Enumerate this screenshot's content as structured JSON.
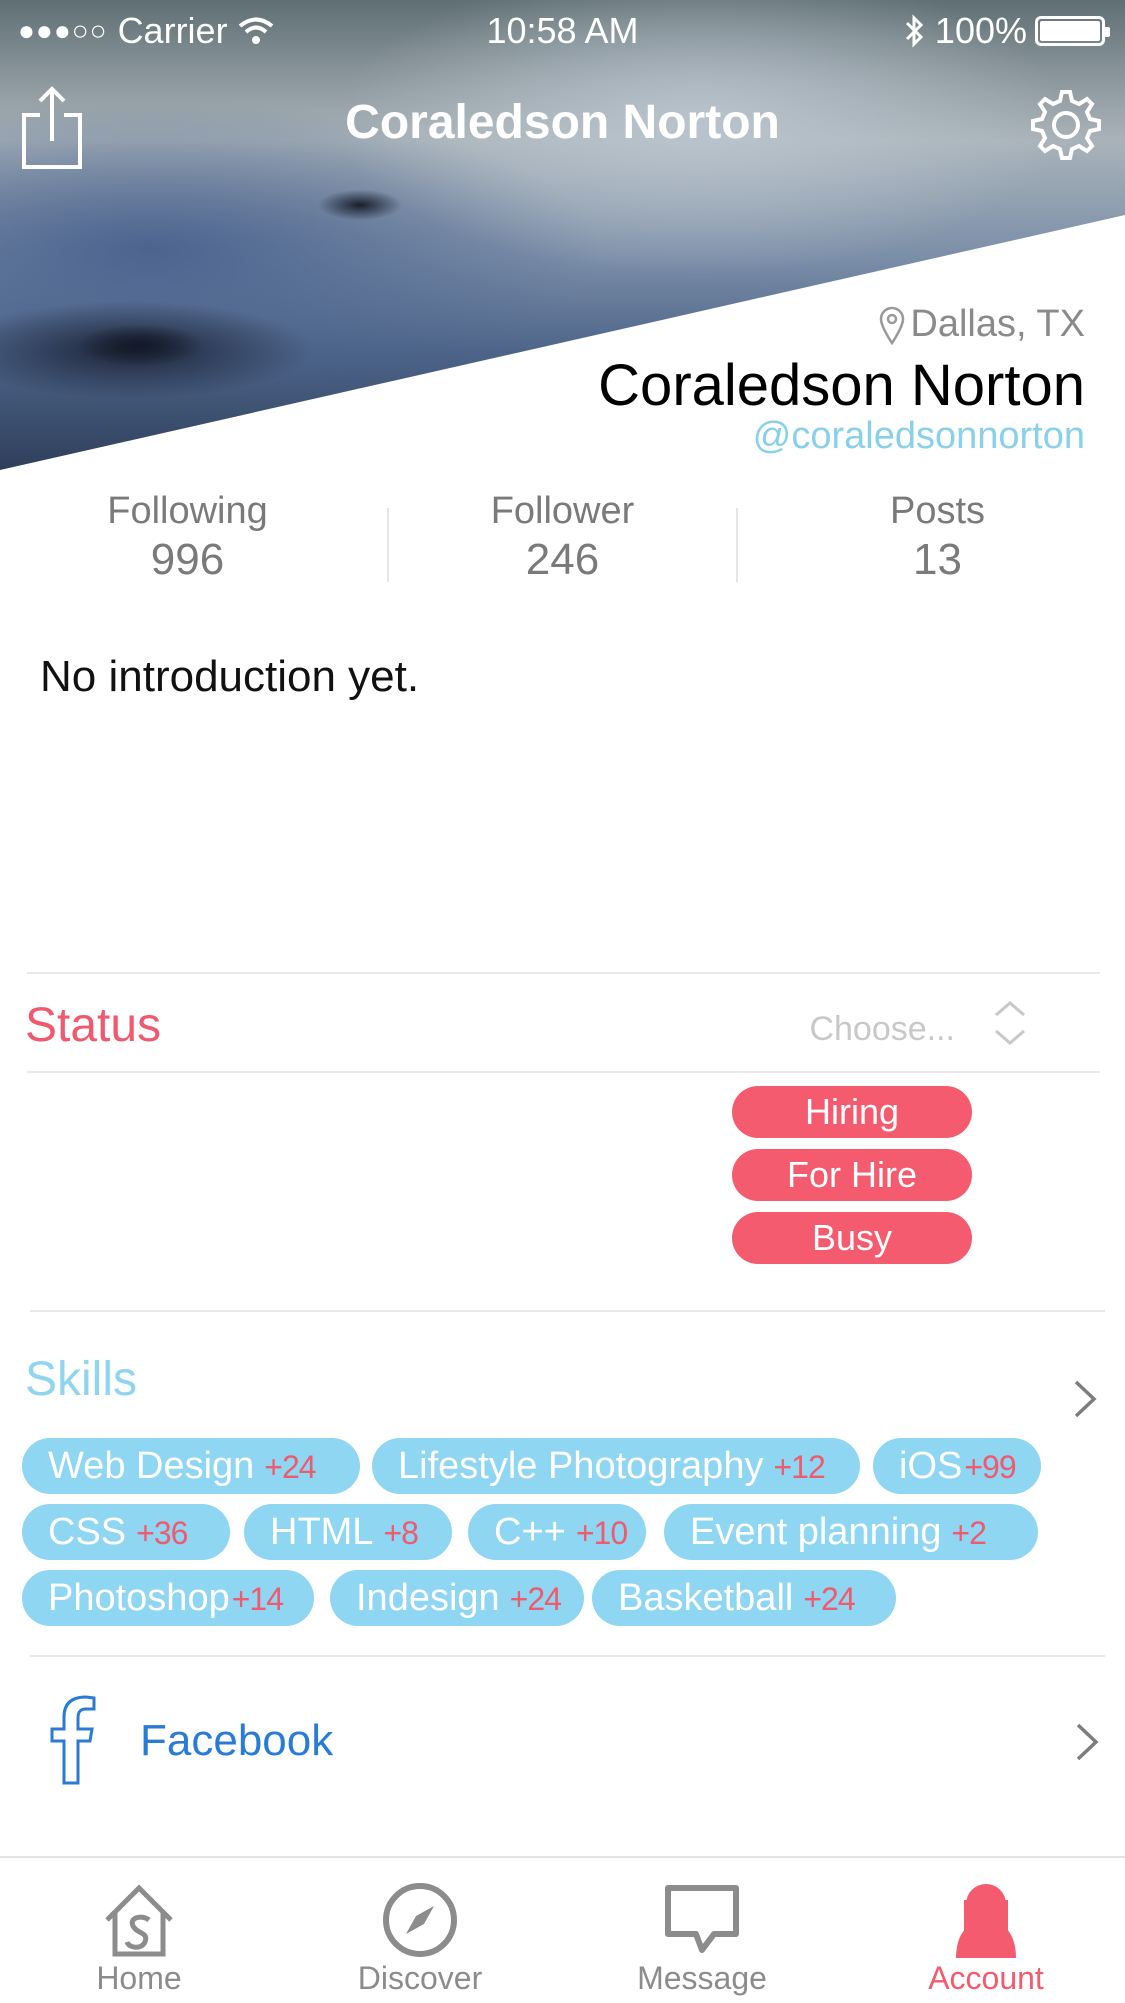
{
  "status_bar": {
    "signal": "●●●○○",
    "carrier": "Carrier",
    "time": "10:58 AM",
    "battery": "100%"
  },
  "nav": {
    "title": "Coraledson Norton",
    "share_icon": "share-icon",
    "settings_icon": "gear-icon"
  },
  "profile": {
    "location": "Dallas, TX",
    "name": "Coraledson Norton",
    "handle": "@coraledsonnorton"
  },
  "stats": [
    {
      "label": "Following",
      "value": "996"
    },
    {
      "label": "Follower",
      "value": "246"
    },
    {
      "label": "Posts",
      "value": "13"
    }
  ],
  "intro": "No introduction yet.",
  "status": {
    "title": "Status",
    "placeholder": "Choose...",
    "options": [
      "Hiring",
      "For Hire",
      "Busy"
    ]
  },
  "skills": {
    "title": "Skills",
    "items": [
      {
        "name": "Web Design",
        "count": "+24"
      },
      {
        "name": "Lifestyle Photography",
        "count": "+12"
      },
      {
        "name": "iOS",
        "count": "+99"
      },
      {
        "name": "CSS",
        "count": "+36"
      },
      {
        "name": "HTML",
        "count": "+8"
      },
      {
        "name": "C++",
        "count": "+10"
      },
      {
        "name": "Event planning",
        "count": "+2"
      },
      {
        "name": "Photoshop",
        "count": "+14"
      },
      {
        "name": "Indesign",
        "count": "+24"
      },
      {
        "name": "Basketball",
        "count": "+24"
      }
    ]
  },
  "social": {
    "facebook": "Facebook"
  },
  "tabs": [
    {
      "label": "Home",
      "icon": "home-icon"
    },
    {
      "label": "Discover",
      "icon": "compass-icon"
    },
    {
      "label": "Message",
      "icon": "message-icon"
    },
    {
      "label": "Account",
      "icon": "account-icon",
      "active": true
    }
  ],
  "colors": {
    "accent_red": "#f45b6e",
    "skill_blue": "#8ed6f1",
    "handle_blue": "#89d0ea",
    "facebook_blue": "#2a7bd3"
  }
}
